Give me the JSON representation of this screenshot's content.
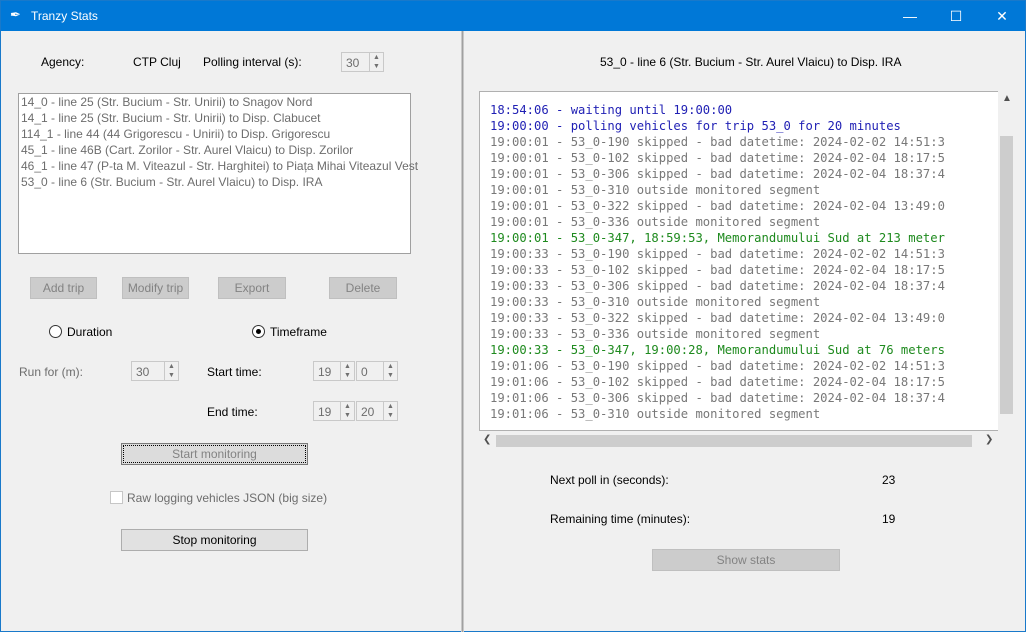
{
  "window": {
    "title": "Tranzy Stats",
    "minimize": "—",
    "maximize": "☐",
    "close": "✕"
  },
  "left": {
    "agency_label": "Agency:",
    "agency_value": "CTP Cluj",
    "polling_label": "Polling interval (s):",
    "polling_value": "30",
    "trips": [
      "14_0 - line 25 (Str. Bucium - Str. Unirii) to Snagov Nord",
      "14_1 - line 25 (Str. Bucium - Str. Unirii) to Disp. Clabucet",
      "114_1 - line 44 (44 Grigorescu - Unirii) to Disp. Grigorescu",
      "45_1 - line 46B (Cart. Zorilor - Str. Aurel Vlaicu) to Disp. Zorilor",
      "46_1 - line 47 (P-ta M. Viteazul - Str. Harghitei) to Piața Mihai Viteazul Vest",
      "53_0 - line 6 (Str. Bucium - Str. Aurel Vlaicu) to Disp. IRA"
    ],
    "add_trip": "Add trip",
    "modify_trip": "Modify trip",
    "export": "Export",
    "delete": "Delete",
    "duration_label": "Duration",
    "timeframe_label": "Timeframe",
    "run_for_label": "Run for (m):",
    "run_for_value": "30",
    "start_time_label": "Start time:",
    "start_hour": "19",
    "start_min": "0",
    "end_time_label": "End time:",
    "end_hour": "19",
    "end_min": "20",
    "start_monitoring": "Start monitoring",
    "raw_logging_label": "Raw logging vehicles JSON (big size)",
    "stop_monitoring": "Stop monitoring"
  },
  "right": {
    "header": "53_0 - line 6 (Str. Bucium - Str. Aurel Vlaicu) to Disp. IRA",
    "log": [
      {
        "text": "18:54:06 - waiting until 19:00:00",
        "color": "blue"
      },
      {
        "text": "19:00:00 - polling vehicles for trip 53_0 for 20 minutes",
        "color": "blue"
      },
      {
        "text": "19:00:01 - 53_0-190 skipped - bad datetime: 2024-02-02 14:51:3",
        "color": "gray"
      },
      {
        "text": "19:00:01 - 53_0-102 skipped - bad datetime: 2024-02-04 18:17:5",
        "color": "gray"
      },
      {
        "text": "19:00:01 - 53_0-306 skipped - bad datetime: 2024-02-04 18:37:4",
        "color": "gray"
      },
      {
        "text": "19:00:01 - 53_0-310 outside monitored segment",
        "color": "gray"
      },
      {
        "text": "19:00:01 - 53_0-322 skipped - bad datetime: 2024-02-04 13:49:0",
        "color": "gray"
      },
      {
        "text": "19:00:01 - 53_0-336 outside monitored segment",
        "color": "gray"
      },
      {
        "text": "19:00:01 - 53_0-347, 18:59:53, Memorandumului Sud at 213 meter",
        "color": "green"
      },
      {
        "text": "19:00:33 - 53_0-190 skipped - bad datetime: 2024-02-02 14:51:3",
        "color": "gray"
      },
      {
        "text": "19:00:33 - 53_0-102 skipped - bad datetime: 2024-02-04 18:17:5",
        "color": "gray"
      },
      {
        "text": "19:00:33 - 53_0-306 skipped - bad datetime: 2024-02-04 18:37:4",
        "color": "gray"
      },
      {
        "text": "19:00:33 - 53_0-310 outside monitored segment",
        "color": "gray"
      },
      {
        "text": "19:00:33 - 53_0-322 skipped - bad datetime: 2024-02-04 13:49:0",
        "color": "gray"
      },
      {
        "text": "19:00:33 - 53_0-336 outside monitored segment",
        "color": "gray"
      },
      {
        "text": "19:00:33 - 53_0-347, 19:00:28, Memorandumului Sud at 76 meters",
        "color": "green"
      },
      {
        "text": "19:01:06 - 53_0-190 skipped - bad datetime: 2024-02-02 14:51:3",
        "color": "gray"
      },
      {
        "text": "19:01:06 - 53_0-102 skipped - bad datetime: 2024-02-04 18:17:5",
        "color": "gray"
      },
      {
        "text": "19:01:06 - 53_0-306 skipped - bad datetime: 2024-02-04 18:37:4",
        "color": "gray"
      },
      {
        "text": "19:01:06 - 53_0-310 outside monitored segment",
        "color": "gray"
      }
    ],
    "next_poll_label": "Next poll in (seconds):",
    "next_poll_value": "23",
    "remaining_label": "Remaining time (minutes):",
    "remaining_value": "19",
    "show_stats": "Show stats"
  },
  "colors": {
    "titlebar": "#0078d7",
    "log_blue": "#1f1fb4",
    "log_green": "#1e8a1e",
    "log_gray": "#787878"
  }
}
